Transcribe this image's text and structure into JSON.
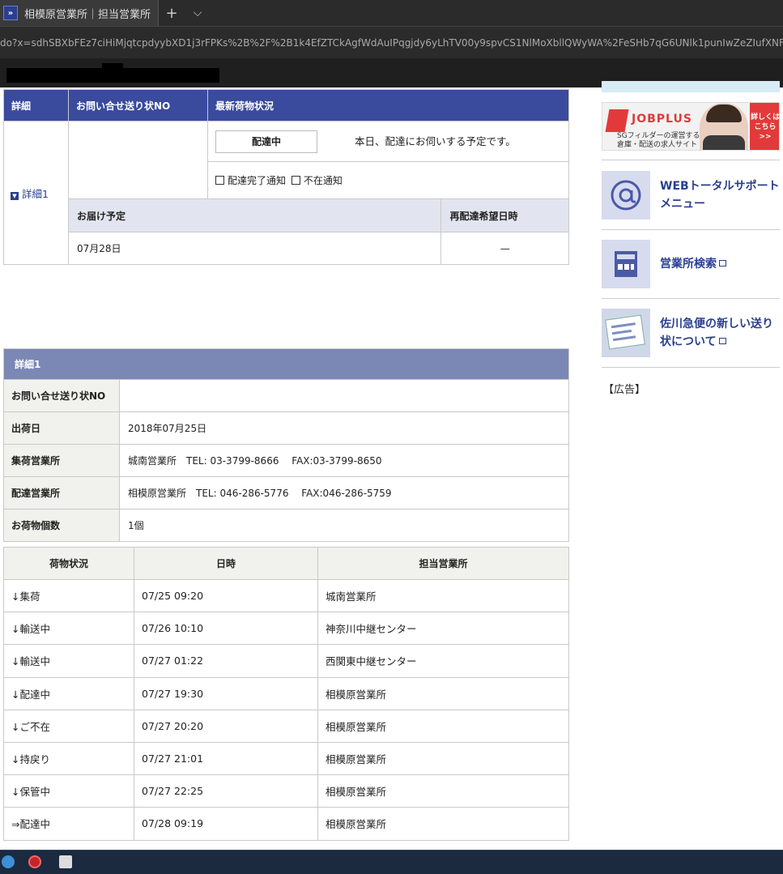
{
  "browser": {
    "tab_title": "相模原営業所｜担当営業所",
    "new_tab": "+",
    "tab_menu": "⌵",
    "url": "do?x=sdhSBXbFEz7ciHiMjqtcpdyybXD1j3rFPKs%2B%2F%2B1k4EfZTCkAgfWdAuIPqgjdy6yLhTV00y9spvCS1NlMoXbllQWyWA%2FeSHb7qG6UNlk1punIwZeZIufXNFfdOqx"
  },
  "summary": {
    "headers": {
      "detail": "詳細",
      "inquiry_no": "お問い合せ送り状NO",
      "latest_status": "最新荷物状況"
    },
    "detail_link": "詳細1",
    "status_label": "配達中",
    "status_message": "本日、配達にお伺いする予定です。",
    "notify_delivered": "配達完了通知",
    "notify_absent": "不在通知",
    "delivery_header": "お届け予定",
    "redelivery_header": "再配達希望日時",
    "delivery_date": "07月28日",
    "redelivery_value": "—"
  },
  "sidebar": {
    "jobplus_brand": "JOBPLUS",
    "jobplus_sub1": "SGフィルダーの運営する",
    "jobplus_sub2": "倉庫・配送の求人サイト",
    "jobplus_cta": "詳しくはこちら>>",
    "web_support": "WEBトータルサポートメニュー",
    "office_search": "営業所検索",
    "new_slip": "佐川急便の新しい送り状について",
    "ad_label": "【広告】"
  },
  "details": {
    "title": "詳細1",
    "rows": [
      {
        "label": "お問い合せ送り状NO",
        "value": ""
      },
      {
        "label": "出荷日",
        "value": "2018年07月25日"
      },
      {
        "label": "集荷営業所",
        "value": "城南営業所　TEL: 03-3799-8666　 FAX:03-3799-8650"
      },
      {
        "label": "配達営業所",
        "value": "相模原営業所　TEL: 046-286-5776　 FAX:046-286-5759"
      },
      {
        "label": "お荷物個数",
        "value": "1個"
      }
    ]
  },
  "tracking": {
    "headers": {
      "status": "荷物状況",
      "datetime": "日時",
      "office": "担当営業所"
    },
    "rows": [
      {
        "status": "↓集荷",
        "datetime": "07/25 09:20",
        "office": "城南営業所"
      },
      {
        "status": "↓輸送中",
        "datetime": "07/26 10:10",
        "office": "神奈川中継センター"
      },
      {
        "status": "↓輸送中",
        "datetime": "07/27 01:22",
        "office": "西関東中継センター"
      },
      {
        "status": "↓配達中",
        "datetime": "07/27 19:30",
        "office": "相模原営業所"
      },
      {
        "status": "↓ご不在",
        "datetime": "07/27 20:20",
        "office": "相模原営業所"
      },
      {
        "status": "↓持戻り",
        "datetime": "07/27 21:01",
        "office": "相模原営業所"
      },
      {
        "status": "↓保管中",
        "datetime": "07/27 22:25",
        "office": "相模原営業所"
      },
      {
        "status": "⇒配達中",
        "datetime": "07/28 09:19",
        "office": "相模原営業所"
      }
    ]
  },
  "colors": {
    "header_blue": "#3a4a9c",
    "detail_header": "#7b87b5",
    "link": "#2a3f8f",
    "jobplus_red": "#e23a3a"
  }
}
